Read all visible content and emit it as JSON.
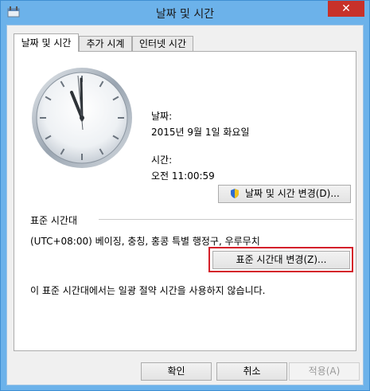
{
  "window": {
    "title": "날짜 및 시간",
    "close_label": "✕"
  },
  "tabs": [
    {
      "label": "날짜 및 시간",
      "active": true
    },
    {
      "label": "추가 시계",
      "active": false
    },
    {
      "label": "인터넷 시간",
      "active": false
    }
  ],
  "datetime": {
    "date_label": "날짜:",
    "date_value": "2015년 9월 1일 화요일",
    "time_label": "시간:",
    "time_value": "오전 11:00:59",
    "change_button": "날짜 및 시간 변경(D)..."
  },
  "timezone": {
    "section_label": "표준 시간대",
    "value": "(UTC+08:00) 베이징, 충칭, 홍콩 특별 행정구, 우루무치",
    "change_button": "표준 시간대 변경(Z)...",
    "dst_note": "이 표준 시간대에서는 일광 절약 시간을 사용하지 않습니다."
  },
  "footer": {
    "ok": "확인",
    "cancel": "취소",
    "apply": "적용(A)"
  },
  "colors": {
    "accent": "#6cb2ea",
    "close": "#c7312a",
    "highlight": "#d4202a"
  }
}
